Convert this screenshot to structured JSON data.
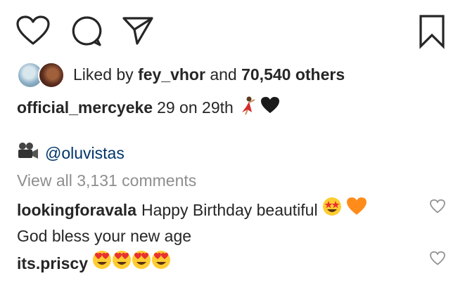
{
  "actions": {
    "like_icon": "heart-outline",
    "comment_icon": "speech-bubble",
    "share_icon": "paper-plane",
    "save_icon": "bookmark-outline"
  },
  "likes": {
    "prefix": "Liked by",
    "user": "fey_vhor",
    "middle": "and",
    "count": "70,540 others"
  },
  "caption": {
    "username": "official_mercyeke",
    "text": "29 on 29th",
    "emojis": [
      "dancer",
      "black-heart"
    ]
  },
  "credit": {
    "icon": "movie-camera",
    "mention": "@oluvistas"
  },
  "view_all_comments": "View all 3,131 comments",
  "comments": [
    {
      "username": "lookingforavala",
      "text_line1": "Happy Birthday beautiful",
      "emojis": [
        "star-struck",
        "orange-heart"
      ],
      "text_line2": "God bless your new age"
    },
    {
      "username": "its.priscy",
      "emojis": [
        "heart-eyes",
        "heart-eyes",
        "heart-eyes",
        "heart-eyes"
      ]
    }
  ],
  "colors": {
    "text": "#262626",
    "muted": "#8e8e8e",
    "mention": "#003569",
    "heart_icon": "#8e8e8e"
  }
}
